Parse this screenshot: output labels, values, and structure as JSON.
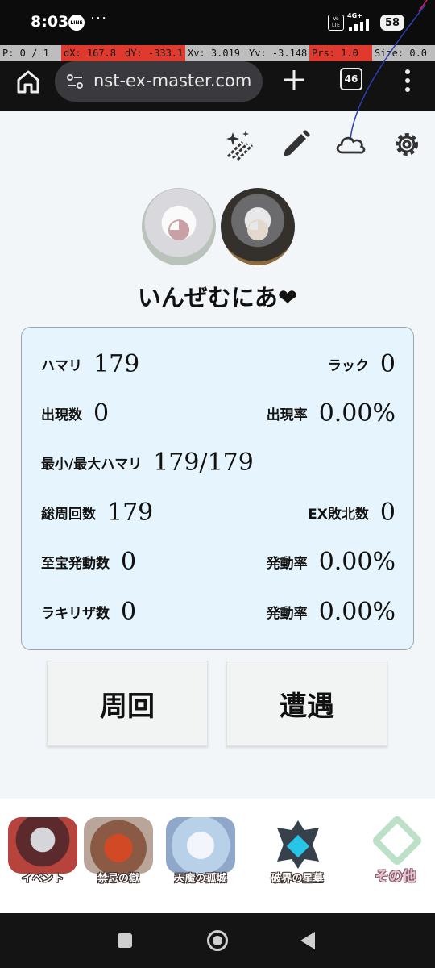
{
  "status_bar": {
    "time": "8:03",
    "line_badge": "LINE",
    "more_dots": "···",
    "volte": "Vo LTE",
    "network": "4G+",
    "battery": "58"
  },
  "debug_bar": {
    "pointer": "P: 0 / 1",
    "dx": "dX: 167.8",
    "dy": "dY: -333.1",
    "xv": "Xv: 3.019",
    "yv": "Yv: -3.148",
    "prs": "Prs: 1.0",
    "size": "Size: 0.0"
  },
  "browser": {
    "url": "nst-ex-master.com",
    "tab_count": "46"
  },
  "profile": {
    "username": "いんぜむにあ❤"
  },
  "stats": {
    "hamari_label": "ハマリ",
    "hamari_value": "179",
    "luck_label": "ラック",
    "luck_value": "0",
    "appear_count_label": "出現数",
    "appear_count_value": "0",
    "appear_rate_label": "出現率",
    "appear_rate_value": "0.00%",
    "minmax_label": "最小/最大ハマリ",
    "minmax_value": "179/179",
    "total_runs_label": "総周回数",
    "total_runs_value": "179",
    "ex_defeat_label": "EX敗北数",
    "ex_defeat_value": "0",
    "treasure_label": "至宝発動数",
    "treasure_value": "0",
    "treasure_rate_label": "発動率",
    "treasure_rate_value": "0.00%",
    "rakiriza_label": "ラキリザ数",
    "rakiriza_value": "0",
    "rakiriza_rate_label": "発動率",
    "rakiriza_rate_value": "0.00%"
  },
  "actions": {
    "run_label": "周回",
    "encounter_label": "遭遇"
  },
  "bottom_nav": {
    "event": "イベント",
    "kinki": "禁忌の獄",
    "tenma": "天魔の孤城",
    "haoku": "破界の星墓",
    "other": "その他"
  },
  "colors": {
    "card_bg": "#e6f5fd",
    "page_bg": "#f3f6f9",
    "debug_red": "#e03a2f",
    "debug_gray": "#bdbdbd"
  }
}
